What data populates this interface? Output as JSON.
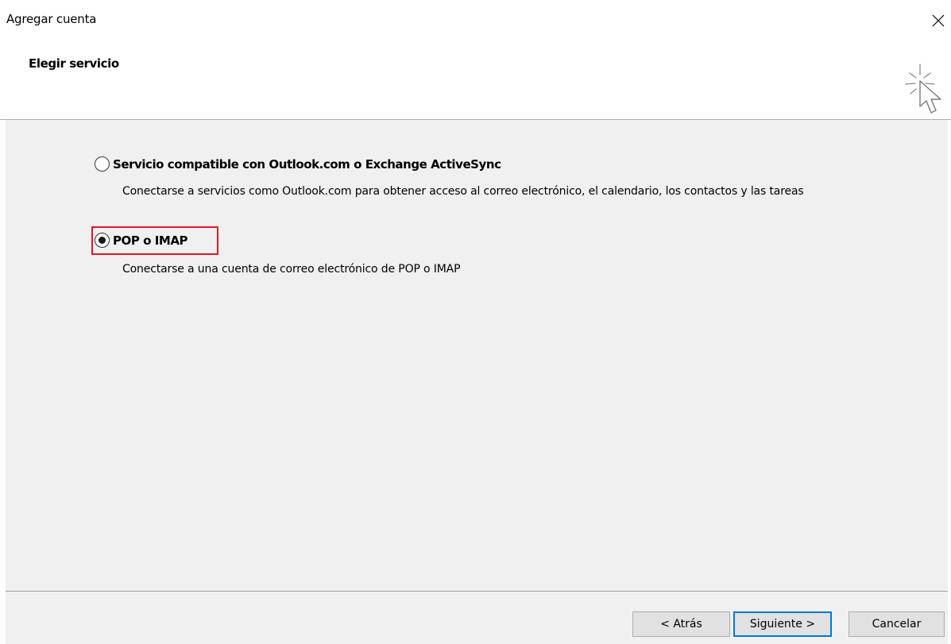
{
  "window": {
    "title": "Agregar cuenta",
    "close_icon": "close-icon"
  },
  "header": {
    "title": "Elegir servicio",
    "icon": "cursor-sparkle-icon"
  },
  "options": [
    {
      "label": "Servicio compatible con Outlook.com o Exchange ActiveSync",
      "description": "Conectarse a servicios como Outlook.com para obtener acceso al correo electrónico, el calendario, los contactos y las tareas",
      "selected": false
    },
    {
      "label": "POP o IMAP",
      "description": "Conectarse a una cuenta de correo electrónico de POP o IMAP",
      "selected": true
    }
  ],
  "highlight_color": "#e8142a",
  "accent_color": "#0078d7",
  "buttons": {
    "back": "< Atrás",
    "next": "Siguiente >",
    "cancel": "Cancelar"
  }
}
